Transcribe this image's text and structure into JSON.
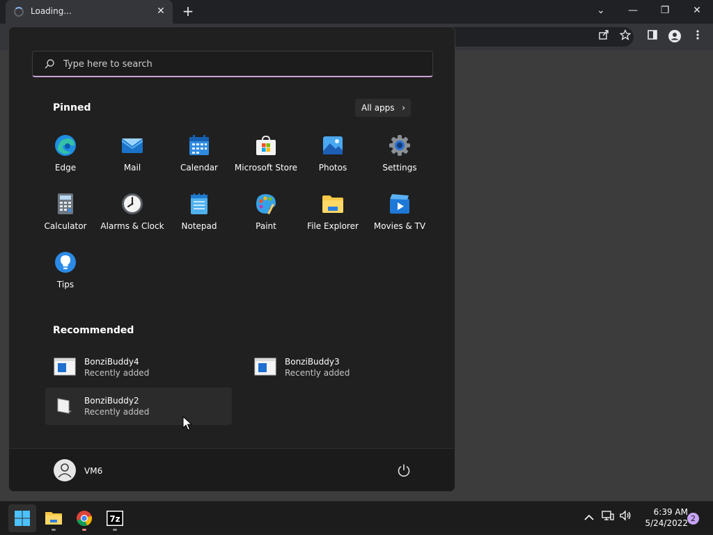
{
  "browser": {
    "tab_title": "Loading...",
    "tab_close_glyph": "✕",
    "new_tab_glyph": "+",
    "window_controls": {
      "tab_search_glyph": "⌄",
      "minimize_glyph": "—",
      "restore_glyph": "❐",
      "close_glyph": "✕"
    },
    "toolbar_icons": [
      "share-icon",
      "star-icon",
      "side-panel-icon",
      "profile-icon",
      "menu-icon"
    ]
  },
  "start_menu": {
    "search": {
      "placeholder": "Type here to search",
      "value": ""
    },
    "pinned_title": "Pinned",
    "all_apps_label": "All apps",
    "all_apps_chevron": "›",
    "pinned_apps": [
      {
        "label": "Edge",
        "icon": "edge-icon"
      },
      {
        "label": "Mail",
        "icon": "mail-icon"
      },
      {
        "label": "Calendar",
        "icon": "calendar-icon"
      },
      {
        "label": "Microsoft Store",
        "icon": "store-icon"
      },
      {
        "label": "Photos",
        "icon": "photos-icon"
      },
      {
        "label": "Settings",
        "icon": "settings-icon"
      },
      {
        "label": "Calculator",
        "icon": "calculator-icon"
      },
      {
        "label": "Alarms & Clock",
        "icon": "clock-icon"
      },
      {
        "label": "Notepad",
        "icon": "notepad-icon"
      },
      {
        "label": "Paint",
        "icon": "paint-icon"
      },
      {
        "label": "File Explorer",
        "icon": "folder-icon"
      },
      {
        "label": "Movies & TV",
        "icon": "movies-icon"
      },
      {
        "label": "Tips",
        "icon": "tips-icon"
      }
    ],
    "recommended_title": "Recommended",
    "recommended": [
      {
        "name": "BonziBuddy4",
        "subtitle": "Recently added"
      },
      {
        "name": "BonziBuddy3",
        "subtitle": "Recently added"
      },
      {
        "name": "BonziBuddy2",
        "subtitle": "Recently added"
      }
    ],
    "user": {
      "name": "VM6"
    }
  },
  "taskbar": {
    "apps": [
      "start-icon",
      "file-explorer-icon",
      "chrome-icon",
      "7zip-icon"
    ],
    "tray": {
      "chevron_glyph": "⌃",
      "speaker_glyph": "🔊"
    },
    "clock": {
      "time": "6:39 AM",
      "date": "5/24/2022"
    },
    "notification_count": "2"
  },
  "colors": {
    "accent": "#c8a4d8",
    "menu_bg": "#202020",
    "taskbar_bg": "#1c1c1c"
  }
}
